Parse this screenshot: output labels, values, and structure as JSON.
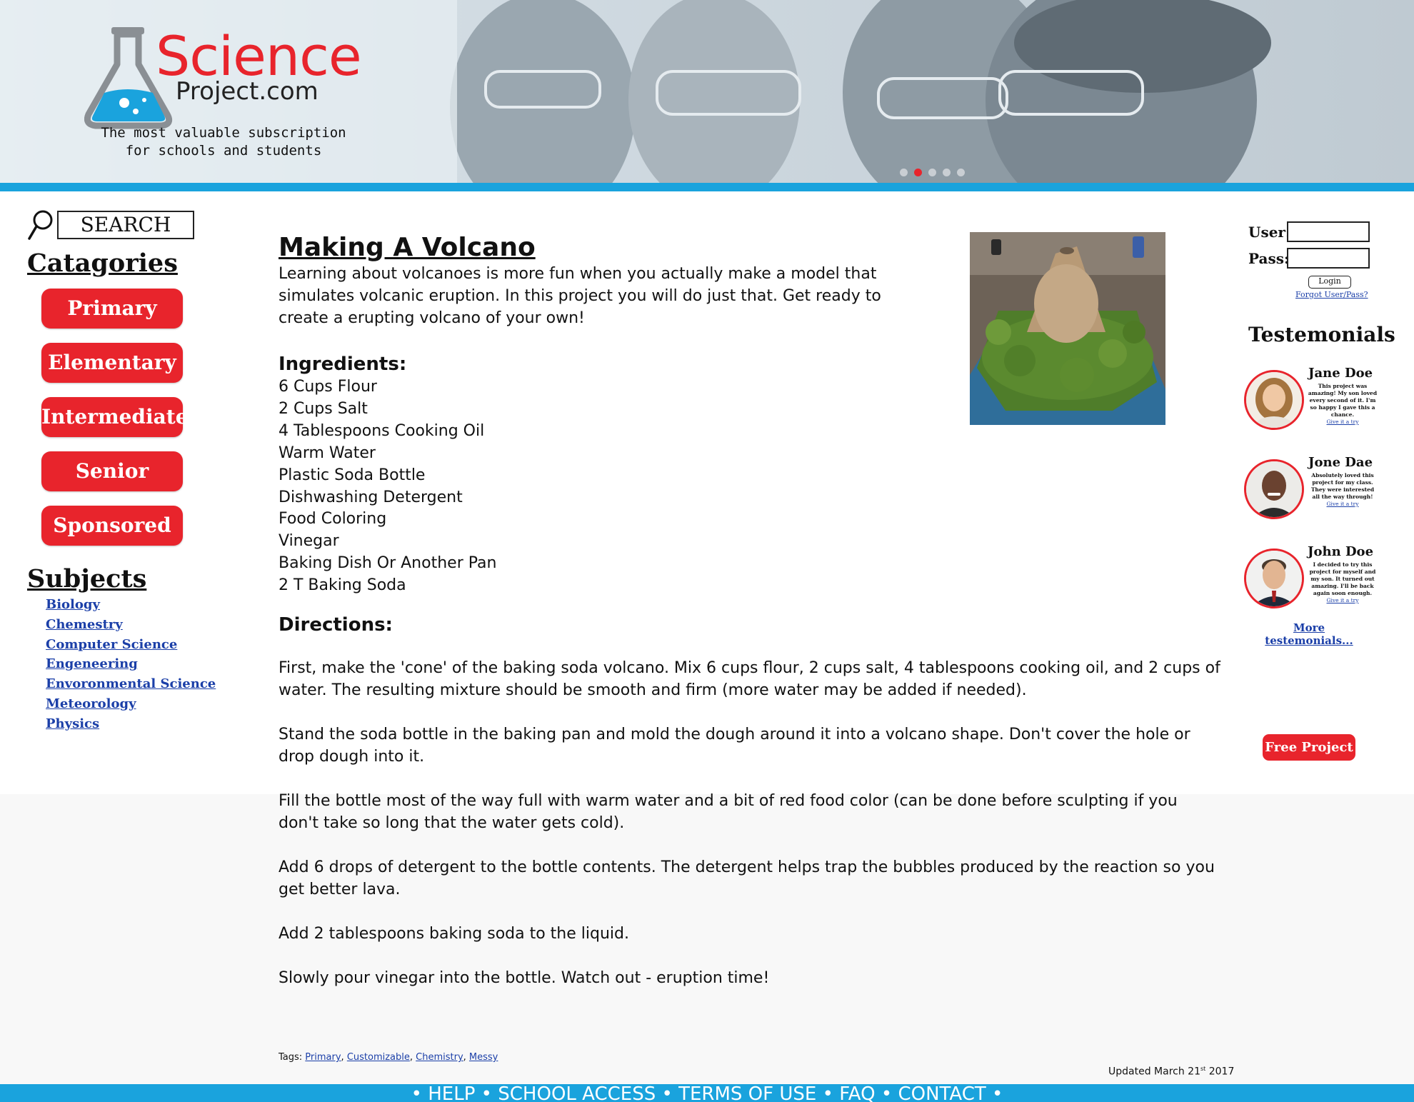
{
  "header": {
    "logo_title": "Science",
    "logo_domain": "Project.com",
    "tagline_line1": "The most valuable subscription",
    "tagline_line2": "for schools and students",
    "carousel_active_index": 1,
    "carousel_dot_count": 5
  },
  "sidebar": {
    "search_label": "SEARCH",
    "categories_heading": "Catagories",
    "categories": [
      "Primary",
      "Elementary",
      "Intermediate",
      "Senior",
      "Sponsored"
    ],
    "subjects_heading": "Subjects",
    "subjects": [
      "Biology",
      "Chemestry",
      "Computer Science",
      "Engeneering",
      "Envoronmental Science",
      "Meteorology",
      "Physics"
    ]
  },
  "article": {
    "title": "Making A Volcano",
    "intro": "Learning about volcanoes is more fun when you actually make a model that simulates volcanic eruption. In this project you will do just that. Get ready to create a erupting volcano of your own!",
    "ingredients_heading": "Ingredients:",
    "ingredients": [
      "6 Cups Flour",
      "2 Cups Salt",
      "4 Tablespoons Cooking Oil",
      "Warm Water",
      "Plastic Soda Bottle",
      "Dishwashing Detergent",
      "Food Coloring",
      "Vinegar",
      "Baking Dish Or Another Pan",
      "2 T Baking Soda"
    ],
    "directions_heading": "Directions:",
    "directions": [
      "First, make the 'cone' of the baking soda volcano. Mix 6 cups flour, 2 cups salt, 4 tablespoons cooking oil, and 2 cups of water. The resulting mixture should be smooth and firm (more water may be added if needed).",
      "Stand the soda bottle in the baking pan and mold the dough around it into a volcano shape. Don't cover the hole or drop dough into it.",
      "Fill the bottle most of the way full with warm water and a bit of red food color (can be done before sculpting if you don't take so long that the water gets cold).",
      "Add 6 drops of detergent to the bottle contents. The detergent helps trap the bubbles produced by the reaction so you get better lava.",
      "Add 2 tablespoons baking soda to the liquid.",
      "Slowly pour vinegar into the bottle. Watch out - eruption time!"
    ],
    "tags_label": "Tags: ",
    "tags": [
      "Primary",
      "Customizable",
      "Chemistry",
      "Messy"
    ],
    "tag_separator": ", ",
    "updated_prefix": "Updated March 21",
    "updated_sup": "st",
    "updated_suffix": " 2017"
  },
  "login": {
    "user_label": "User:",
    "pass_label": "Pass:",
    "button_label": "Login",
    "forgot_label": "Forgot User/Pass?"
  },
  "testimonials": {
    "heading": "Testemonials",
    "items": [
      {
        "name": "Jane Doe",
        "quote": "This project was amazing! My son loved every second of it. I'm so happy I gave this a chance.",
        "link": "Give it a try"
      },
      {
        "name": "Jone Dae",
        "quote": "Absolutely loved this project for my class. They were interested all the way through!",
        "link": "Give it a try"
      },
      {
        "name": "John Doe",
        "quote": "I decided to try this project for myself and my son. It turned out amazing. I'll be back again soon enough.",
        "link": "Give it a try"
      }
    ],
    "more_label": "More testemonials...",
    "free_project_label": "Free Project"
  },
  "footer": {
    "bullet": "•",
    "links": [
      "HELP",
      "SCHOOL ACCESS",
      "TERMS OF USE",
      "FAQ",
      "CONTACT"
    ]
  },
  "colors": {
    "brand_red": "#e8242c",
    "brand_blue": "#1aa3dd",
    "link_blue": "#1b3fa8"
  }
}
